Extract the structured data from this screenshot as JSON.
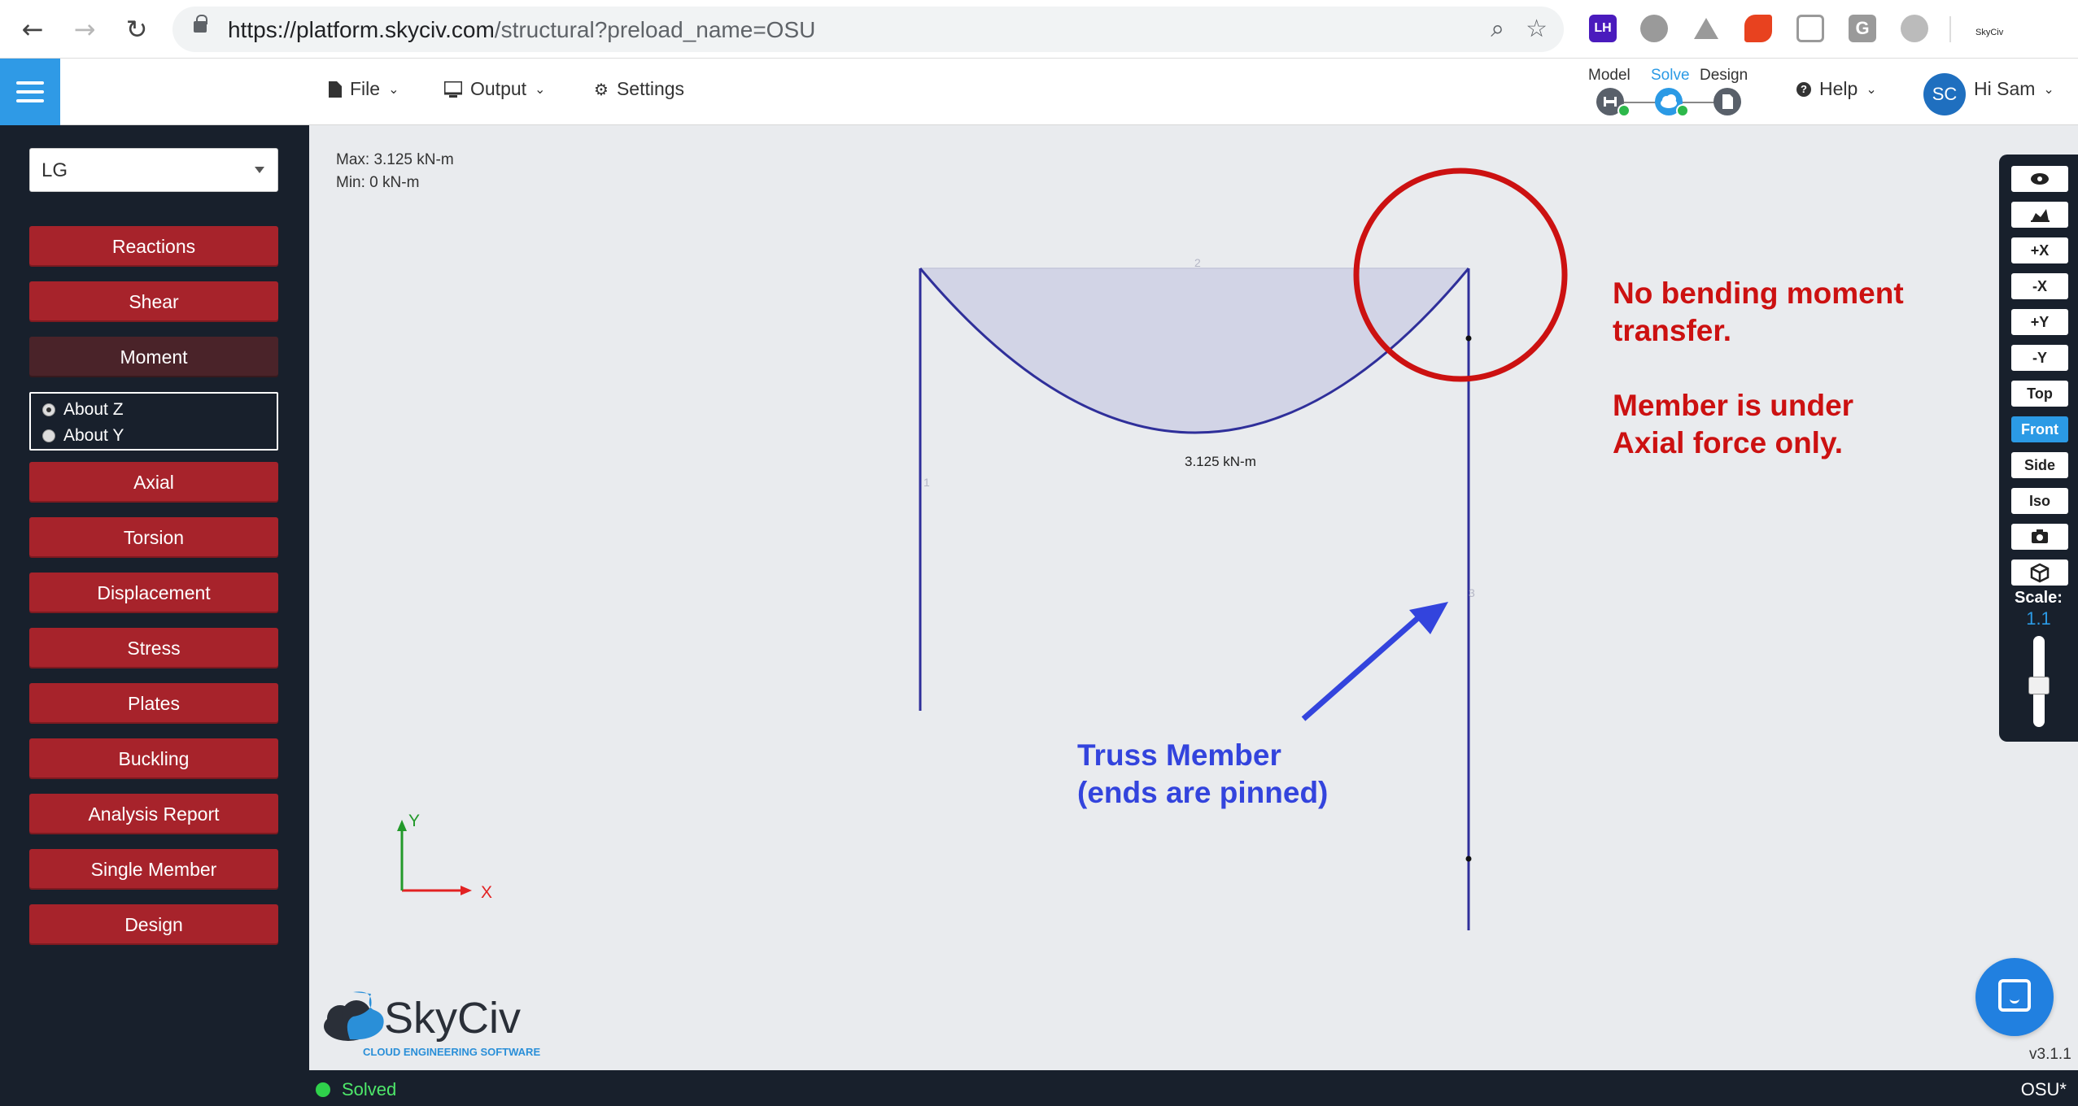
{
  "browser": {
    "url_main": "https://platform.skyciv.com",
    "url_path": "/structural?preload_name=OSU",
    "ext_lh": "LH",
    "ext_g": "G",
    "ext_skyciv": "SkyCiv"
  },
  "header": {
    "menu": [
      {
        "label": "File"
      },
      {
        "label": "Output"
      },
      {
        "label": "Settings"
      }
    ],
    "modes": [
      {
        "label": "Model"
      },
      {
        "label": "Solve"
      },
      {
        "label": "Design"
      }
    ],
    "help_label": "Help",
    "user_initials": "SC",
    "user_greeting": "Hi Sam"
  },
  "sidebar": {
    "load_case": "LG",
    "buttons_top": [
      "Reactions",
      "Shear",
      "Moment"
    ],
    "radio": [
      "About Z",
      "About Y"
    ],
    "radio_selected": 0,
    "buttons_bottom": [
      "Axial",
      "Torsion",
      "Displacement",
      "Stress",
      "Plates",
      "Buckling",
      "Analysis Report",
      "Single Member",
      "Design"
    ],
    "active_button": "Moment"
  },
  "canvas": {
    "max_text": "Max: 3.125 kN-m",
    "min_text": "Min: 0 kN-m",
    "member_labels": [
      "1",
      "2",
      "3"
    ],
    "moment_label": "3.125 kN-m",
    "axis_x": "X",
    "axis_y": "Y",
    "annot_red": [
      "No bending moment",
      "transfer.",
      "Member is under",
      "Axial force only."
    ],
    "annot_blue": [
      "Truss Member",
      "(ends are pinned)"
    ],
    "colors": {
      "member": "#2f2f9a",
      "diagram_fill": "#d2d4e6",
      "annotation_red": "#cc1111",
      "annotation_blue": "#3344dd"
    }
  },
  "toolbar": {
    "buttons": [
      "+X",
      "-X",
      "+Y",
      "-Y",
      "Top",
      "Front",
      "Side",
      "Iso"
    ],
    "active": "Front",
    "scale_label": "Scale:",
    "scale_value": "1.1"
  },
  "logo": {
    "name": "SkyCiv",
    "tagline": "CLOUD ENGINEERING SOFTWARE"
  },
  "version": "v3.1.1",
  "status": {
    "text": "Solved",
    "project": "OSU*"
  }
}
